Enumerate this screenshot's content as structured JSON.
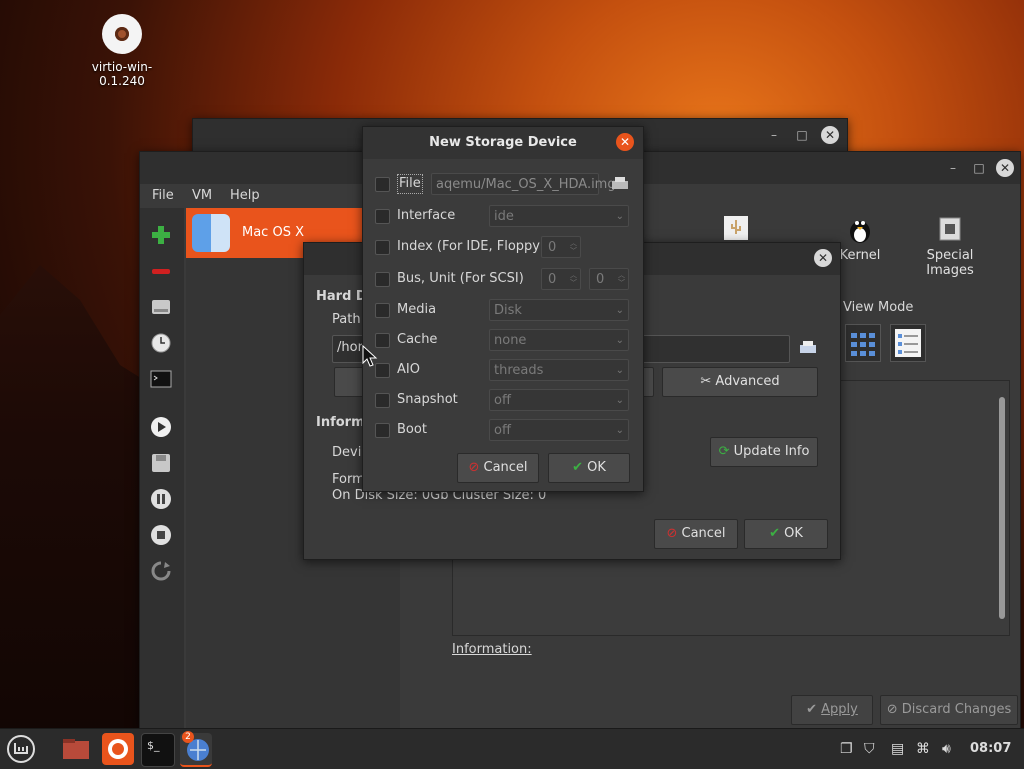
{
  "desktop": {
    "icon_label": "virtio-win-0.1.240"
  },
  "back_window": {
    "minimize": "–",
    "maximize": "□",
    "close": "✕"
  },
  "main_window": {
    "controls": {
      "minimize": "–",
      "maximize": "□",
      "close": "✕"
    },
    "menu": [
      "File",
      "VM",
      "Help"
    ],
    "vm_name": "Mac OS X",
    "hw_buttons": [
      {
        "label": "Kernel",
        "icon": "tux-icon"
      },
      {
        "label": "Special Images",
        "icon": "chip-icon"
      }
    ],
    "view_mode_label": "View Mode",
    "advanced_label": "Advanced",
    "update_info_label": "Update Info",
    "information_label": "Information:",
    "apply_label": "Apply",
    "discard_label": "Discard Changes"
  },
  "hd_dialog": {
    "section_title": "Hard Di",
    "path_label": "Path",
    "path_value": "/hor",
    "info_title": "Informa",
    "device_label": "Devic",
    "format_label": "Form",
    "disk_size": "On Disk Size: 0Gb Cluster Size: 0",
    "cancel_label": "Cancel",
    "ok_label": "OK"
  },
  "new_storage": {
    "title": "New Storage Device",
    "file_label": "File",
    "file_value": "aqemu/Mac_OS_X_HDA.img",
    "interface_label": "Interface",
    "interface_value": "ide",
    "index_label": "Index (For IDE, Floppy)",
    "index_value": "0",
    "bus_label": "Bus, Unit (For SCSI)",
    "bus_value": "0",
    "unit_value": "0",
    "media_label": "Media",
    "media_value": "Disk",
    "cache_label": "Cache",
    "cache_value": "none",
    "aio_label": "AIO",
    "aio_value": "threads",
    "snapshot_label": "Snapshot",
    "snapshot_value": "off",
    "boot_label": "Boot",
    "boot_value": "off",
    "cancel_label": "Cancel",
    "ok_label": "OK"
  },
  "taskbar": {
    "notification_count": "2",
    "clock": "08:07"
  }
}
